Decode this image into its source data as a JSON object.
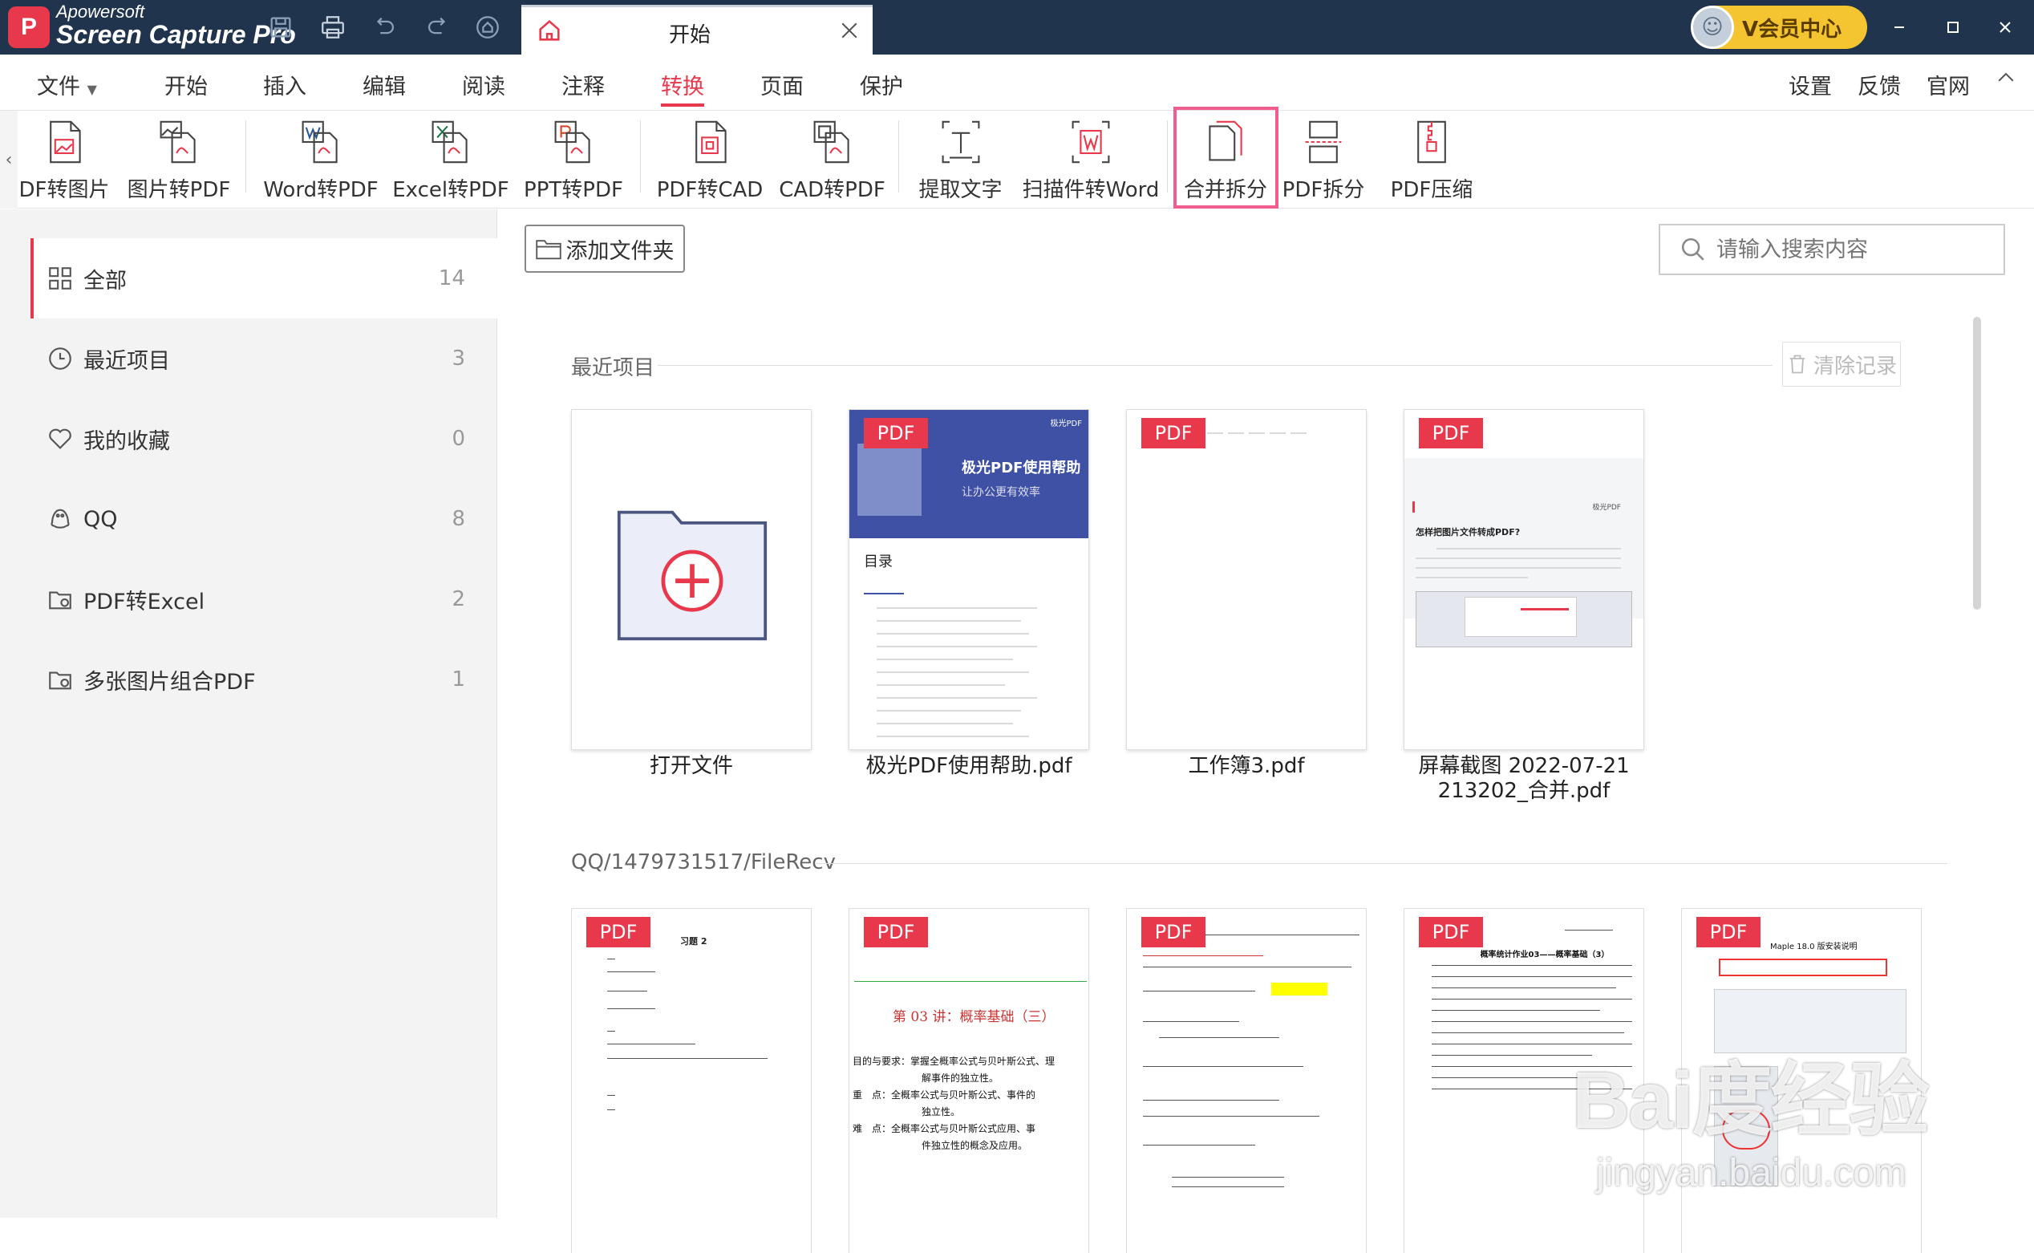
{
  "app": {
    "logo_text": "P",
    "brand_line1": "Apowersoft",
    "brand_line2": "Screen Capture Pro"
  },
  "tab": {
    "title": "开始"
  },
  "vip": {
    "label": "V会员中心"
  },
  "menu": {
    "items": [
      "文件",
      "开始",
      "插入",
      "编辑",
      "阅读",
      "注释",
      "转换",
      "页面",
      "保护"
    ],
    "active": "转换",
    "right": [
      "设置",
      "反馈",
      "官网"
    ]
  },
  "toolbar": {
    "tools": [
      "DF转图片",
      "图片转PDF",
      "Word转PDF",
      "Excel转PDF",
      "PPT转PDF",
      "PDF转CAD",
      "CAD转PDF",
      "提取文字",
      "扫描件转Word",
      "合并拆分",
      "PDF拆分",
      "PDF压缩"
    ],
    "highlighted": "合并拆分"
  },
  "sidebar": {
    "items": [
      {
        "label": "全部",
        "count": "14",
        "icon": "grid-icon"
      },
      {
        "label": "最近项目",
        "count": "3",
        "icon": "clock-icon"
      },
      {
        "label": "我的收藏",
        "count": "0",
        "icon": "heart-icon"
      },
      {
        "label": "QQ",
        "count": "8",
        "icon": "qq-icon"
      },
      {
        "label": "PDF转Excel",
        "count": "2",
        "icon": "folder-icon"
      },
      {
        "label": "多张图片组合PDF",
        "count": "1",
        "icon": "folder-icon"
      }
    ]
  },
  "main": {
    "add_folder": "添加文件夹",
    "search_placeholder": "请输入搜索内容",
    "recent_title": "最近项目",
    "clear_label": "清除记录",
    "pdf_tag": "PDF",
    "recent_cards": [
      {
        "name": "打开文件"
      },
      {
        "name": "极光PDF使用帮助.pdf"
      },
      {
        "name": "工作簿3.pdf"
      },
      {
        "name": "屏幕截图 2022-07-21 213202_合并.pdf"
      }
    ],
    "qq_title": "QQ/1479731517/FileRecv",
    "thumb1": {
      "banner_title": "极光PDF使用帮助",
      "banner_sub": "让办公更有效率",
      "toc": "目录",
      "brand": "极光PDF"
    },
    "thumb3": {
      "brand": "极光PDF",
      "heading": "怎样把图片文件转成PDF?"
    },
    "qq_thumbs": {
      "t1_title": "习题 2",
      "t2_title": "第 03 讲：概率基础（三）",
      "t2_lines": [
        "目的与要求：掌握全概率公式与贝叶斯公式、理",
        "解事件的独立性。",
        "重　点：全概率公式与贝叶斯公式、事件的",
        "独立性。",
        "难　点：全概率公式与贝叶斯公式应用、事",
        "件独立性的概念及应用。"
      ],
      "t4_title": "概率统计作业03——概率基础（3）",
      "t5_title": "Maple 18.0 版安装说明"
    }
  },
  "watermark": {
    "line1": "Bai度经验",
    "line2": "jingyan.baidu.com"
  },
  "colors": {
    "title_bg": "#21344d",
    "accent": "#e8384c",
    "highlight": "#f05d8c",
    "vip": "#f4c531"
  }
}
